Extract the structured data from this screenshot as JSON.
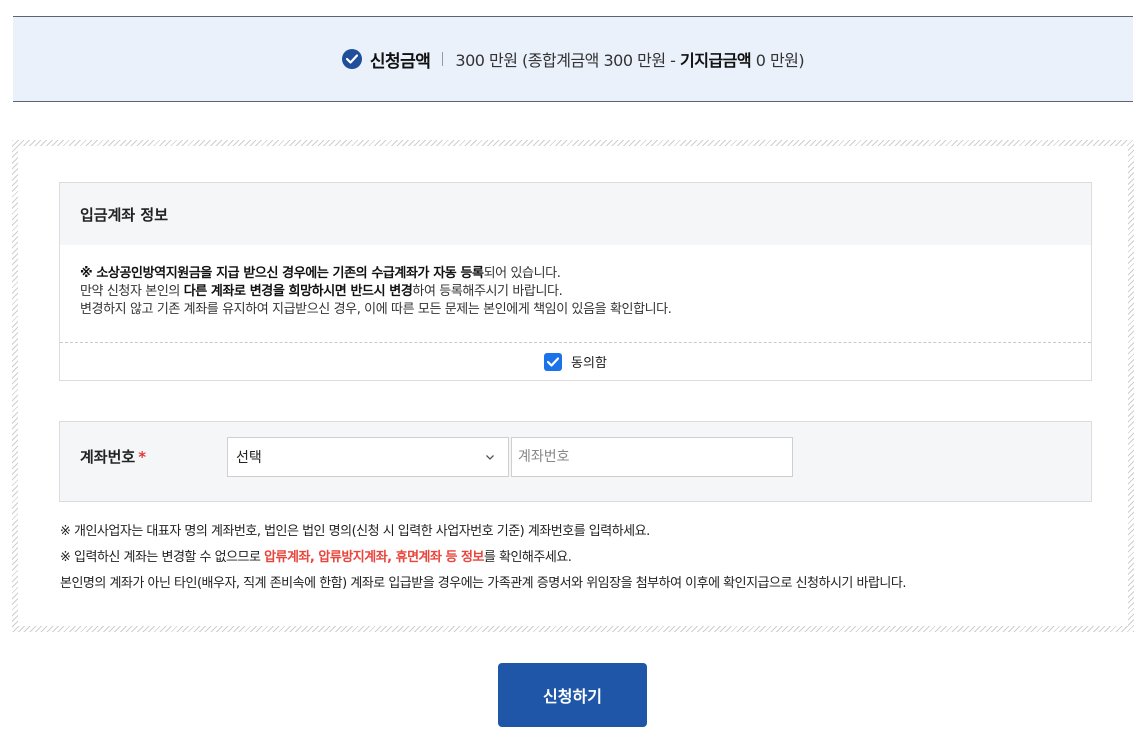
{
  "summary": {
    "title": "신청금액",
    "amount_prefix": "300 만원 (종합계금액 300 만원 - ",
    "amount_bold": "기지급금액",
    "amount_suffix": " 0 만원)"
  },
  "account_info": {
    "header": "입금계좌 정보",
    "notice_line1_bold": "※ 소상공인방역지원금을 지급 받으신 경우에는 기존의 수급계좌가 자동 등록",
    "notice_line1_rest": "되어 있습니다.",
    "notice_line2_pre": "만약 신청자 본인의 ",
    "notice_line2_bold": "다른 계좌로 변경을 희망하시면 반드시 변경",
    "notice_line2_post": "하여 등록해주시기 바랍니다.",
    "notice_line3": "변경하지 않고 기존 계좌를 유지하여 지급받으신 경우, 이에 따른 모든 문제는 본인에게 책임이 있음을 확인합니다.",
    "agree_label": "동의함",
    "agree_checked": true
  },
  "account_number": {
    "label": "계좌번호",
    "required_mark": "*",
    "bank_select_value": "선택",
    "input_placeholder": "계좌번호"
  },
  "guides": {
    "line1": "※ 개인사업자는 대표자 명의 계좌번호, 법인은 법인 명의(신청 시 입력한 사업자번호 기준) 계좌번호를 입력하세요.",
    "line2_pre": "※ 입력하신 계좌는 변경할 수 없으므로 ",
    "line2_red": "압류계좌, 압류방지계좌, 휴면계좌 등 정보",
    "line2_post": "를 확인해주세요.",
    "line3": "본인명의 계좌가 아닌 타인(배우자, 직계 존비속에 한함) 계좌로 입급받을 경우에는 가족관계 증명서와 위임장을 첨부하여 이후에 확인지급으로 신청하시기 바랍니다."
  },
  "submit_label": "신청하기",
  "colors": {
    "primary": "#1f56a8",
    "checkbox": "#1a73e8",
    "warning_red": "#e8453c",
    "summary_bg": "#eaf1fb"
  }
}
